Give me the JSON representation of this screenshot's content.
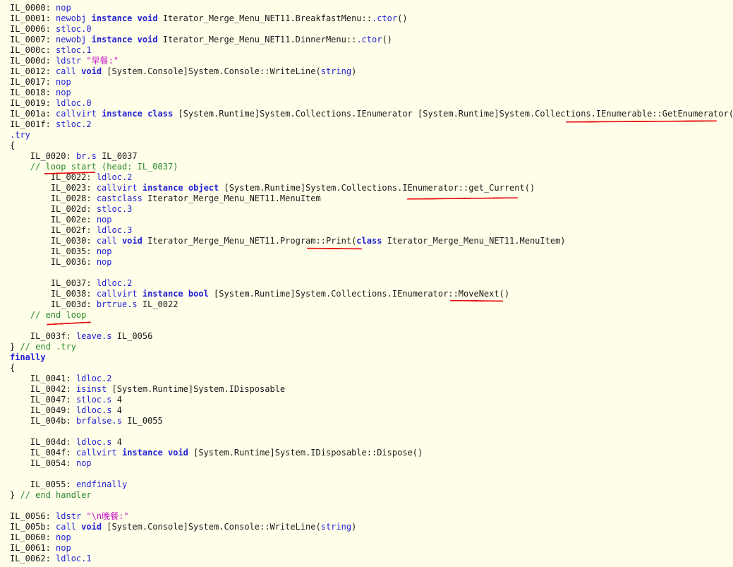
{
  "lines": [
    [
      [
        "lbl",
        "IL_0000: "
      ],
      [
        "op",
        "nop"
      ]
    ],
    [
      [
        "lbl",
        "IL_0001: "
      ],
      [
        "op",
        "newobj "
      ],
      [
        "kw",
        "instance "
      ],
      [
        "kw",
        "void "
      ],
      [
        "tx",
        "Iterator_Merge_Menu_NET11.BreakfastMenu::"
      ],
      [
        "op",
        ".ctor"
      ],
      [
        "tx",
        "()"
      ]
    ],
    [
      [
        "lbl",
        "IL_0006: "
      ],
      [
        "op",
        "stloc.0"
      ]
    ],
    [
      [
        "lbl",
        "IL_0007: "
      ],
      [
        "op",
        "newobj "
      ],
      [
        "kw",
        "instance "
      ],
      [
        "kw",
        "void "
      ],
      [
        "tx",
        "Iterator_Merge_Menu_NET11.DinnerMenu::"
      ],
      [
        "op",
        ".ctor"
      ],
      [
        "tx",
        "()"
      ]
    ],
    [
      [
        "lbl",
        "IL_000c: "
      ],
      [
        "op",
        "stloc.1"
      ]
    ],
    [
      [
        "lbl",
        "IL_000d: "
      ],
      [
        "op",
        "ldstr "
      ],
      [
        "str",
        "\"早餐:\""
      ]
    ],
    [
      [
        "lbl",
        "IL_0012: "
      ],
      [
        "op",
        "call "
      ],
      [
        "kw",
        "void "
      ],
      [
        "tx",
        "[System.Console]System.Console::WriteLine("
      ],
      [
        "op",
        "string"
      ],
      [
        "tx",
        ")"
      ]
    ],
    [
      [
        "lbl",
        "IL_0017: "
      ],
      [
        "op",
        "nop"
      ]
    ],
    [
      [
        "lbl",
        "IL_0018: "
      ],
      [
        "op",
        "nop"
      ]
    ],
    [
      [
        "lbl",
        "IL_0019: "
      ],
      [
        "op",
        "ldloc.0"
      ]
    ],
    [
      [
        "lbl",
        "IL_001a: "
      ],
      [
        "op",
        "callvirt "
      ],
      [
        "kw",
        "instance "
      ],
      [
        "kw",
        "class "
      ],
      [
        "tx",
        "[System.Runtime]System.Collections.IEnumerator [System.Runtime]System.Collections.IEnumerable::GetEnumerator()"
      ]
    ],
    [
      [
        "lbl",
        "IL_001f: "
      ],
      [
        "op",
        "stloc.2"
      ]
    ],
    [
      [
        "op",
        ".try"
      ]
    ],
    [
      [
        "tx",
        "{"
      ]
    ],
    [
      [
        "tx",
        "    "
      ],
      [
        "lbl",
        "IL_0020: "
      ],
      [
        "op",
        "br.s "
      ],
      [
        "tx",
        "IL_0037"
      ]
    ],
    [
      [
        "tx",
        "    "
      ],
      [
        "cm",
        "// loop start (head: IL_0037)"
      ]
    ],
    [
      [
        "tx",
        "        "
      ],
      [
        "lbl",
        "IL_0022: "
      ],
      [
        "op",
        "ldloc.2"
      ]
    ],
    [
      [
        "tx",
        "        "
      ],
      [
        "lbl",
        "IL_0023: "
      ],
      [
        "op",
        "callvirt "
      ],
      [
        "kw",
        "instance "
      ],
      [
        "kw",
        "object "
      ],
      [
        "tx",
        "[System.Runtime]System.Collections.IEnumerator::get_Current()"
      ]
    ],
    [
      [
        "tx",
        "        "
      ],
      [
        "lbl",
        "IL_0028: "
      ],
      [
        "op",
        "castclass "
      ],
      [
        "tx",
        "Iterator_Merge_Menu_NET11.MenuItem"
      ]
    ],
    [
      [
        "tx",
        "        "
      ],
      [
        "lbl",
        "IL_002d: "
      ],
      [
        "op",
        "stloc.3"
      ]
    ],
    [
      [
        "tx",
        "        "
      ],
      [
        "lbl",
        "IL_002e: "
      ],
      [
        "op",
        "nop"
      ]
    ],
    [
      [
        "tx",
        "        "
      ],
      [
        "lbl",
        "IL_002f: "
      ],
      [
        "op",
        "ldloc.3"
      ]
    ],
    [
      [
        "tx",
        "        "
      ],
      [
        "lbl",
        "IL_0030: "
      ],
      [
        "op",
        "call "
      ],
      [
        "kw",
        "void "
      ],
      [
        "tx",
        "Iterator_Merge_Menu_NET11.Program::Print("
      ],
      [
        "kw",
        "class "
      ],
      [
        "tx",
        "Iterator_Merge_Menu_NET11.MenuItem)"
      ]
    ],
    [
      [
        "tx",
        "        "
      ],
      [
        "lbl",
        "IL_0035: "
      ],
      [
        "op",
        "nop"
      ]
    ],
    [
      [
        "tx",
        "        "
      ],
      [
        "lbl",
        "IL_0036: "
      ],
      [
        "op",
        "nop"
      ]
    ],
    [],
    [
      [
        "tx",
        "        "
      ],
      [
        "lbl",
        "IL_0037: "
      ],
      [
        "op",
        "ldloc.2"
      ]
    ],
    [
      [
        "tx",
        "        "
      ],
      [
        "lbl",
        "IL_0038: "
      ],
      [
        "op",
        "callvirt "
      ],
      [
        "kw",
        "instance "
      ],
      [
        "kw",
        "bool "
      ],
      [
        "tx",
        "[System.Runtime]System.Collections.IEnumerator::MoveNext()"
      ]
    ],
    [
      [
        "tx",
        "        "
      ],
      [
        "lbl",
        "IL_003d: "
      ],
      [
        "op",
        "brtrue.s "
      ],
      [
        "tx",
        "IL_0022"
      ]
    ],
    [
      [
        "tx",
        "    "
      ],
      [
        "cm",
        "// end loop"
      ]
    ],
    [],
    [
      [
        "tx",
        "    "
      ],
      [
        "lbl",
        "IL_003f: "
      ],
      [
        "op",
        "leave.s "
      ],
      [
        "tx",
        "IL_0056"
      ]
    ],
    [
      [
        "tx",
        "} "
      ],
      [
        "cm",
        "// end .try"
      ]
    ],
    [
      [
        "kw",
        "finally"
      ]
    ],
    [
      [
        "tx",
        "{"
      ]
    ],
    [
      [
        "tx",
        "    "
      ],
      [
        "lbl",
        "IL_0041: "
      ],
      [
        "op",
        "ldloc.2"
      ]
    ],
    [
      [
        "tx",
        "    "
      ],
      [
        "lbl",
        "IL_0042: "
      ],
      [
        "op",
        "isinst "
      ],
      [
        "tx",
        "[System.Runtime]System.IDisposable"
      ]
    ],
    [
      [
        "tx",
        "    "
      ],
      [
        "lbl",
        "IL_0047: "
      ],
      [
        "op",
        "stloc.s "
      ],
      [
        "tx",
        "4"
      ]
    ],
    [
      [
        "tx",
        "    "
      ],
      [
        "lbl",
        "IL_0049: "
      ],
      [
        "op",
        "ldloc.s "
      ],
      [
        "tx",
        "4"
      ]
    ],
    [
      [
        "tx",
        "    "
      ],
      [
        "lbl",
        "IL_004b: "
      ],
      [
        "op",
        "brfalse.s "
      ],
      [
        "tx",
        "IL_0055"
      ]
    ],
    [],
    [
      [
        "tx",
        "    "
      ],
      [
        "lbl",
        "IL_004d: "
      ],
      [
        "op",
        "ldloc.s "
      ],
      [
        "tx",
        "4"
      ]
    ],
    [
      [
        "tx",
        "    "
      ],
      [
        "lbl",
        "IL_004f: "
      ],
      [
        "op",
        "callvirt "
      ],
      [
        "kw",
        "instance "
      ],
      [
        "kw",
        "void "
      ],
      [
        "tx",
        "[System.Runtime]System.IDisposable::Dispose()"
      ]
    ],
    [
      [
        "tx",
        "    "
      ],
      [
        "lbl",
        "IL_0054: "
      ],
      [
        "op",
        "nop"
      ]
    ],
    [],
    [
      [
        "tx",
        "    "
      ],
      [
        "lbl",
        "IL_0055: "
      ],
      [
        "op",
        "endfinally"
      ]
    ],
    [
      [
        "tx",
        "} "
      ],
      [
        "cm",
        "// end handler"
      ]
    ],
    [],
    [
      [
        "lbl",
        "IL_0056: "
      ],
      [
        "op",
        "ldstr "
      ],
      [
        "str",
        "\"\\n晚餐:\""
      ]
    ],
    [
      [
        "lbl",
        "IL_005b: "
      ],
      [
        "op",
        "call "
      ],
      [
        "kw",
        "void "
      ],
      [
        "tx",
        "[System.Console]System.Console::WriteLine("
      ],
      [
        "op",
        "string"
      ],
      [
        "tx",
        ")"
      ]
    ],
    [
      [
        "lbl",
        "IL_0060: "
      ],
      [
        "op",
        "nop"
      ]
    ],
    [
      [
        "lbl",
        "IL_0061: "
      ],
      [
        "op",
        "nop"
      ]
    ],
    [
      [
        "lbl",
        "IL_0062: "
      ],
      [
        "op",
        "ldloc.1"
      ]
    ]
  ],
  "colors": {
    "background": "#fffee9",
    "opcode": "#1f1fd6",
    "string": "#c71ac7",
    "comment": "#2a8a2a",
    "text": "#1a1a1a",
    "annotation": "#e81010"
  }
}
